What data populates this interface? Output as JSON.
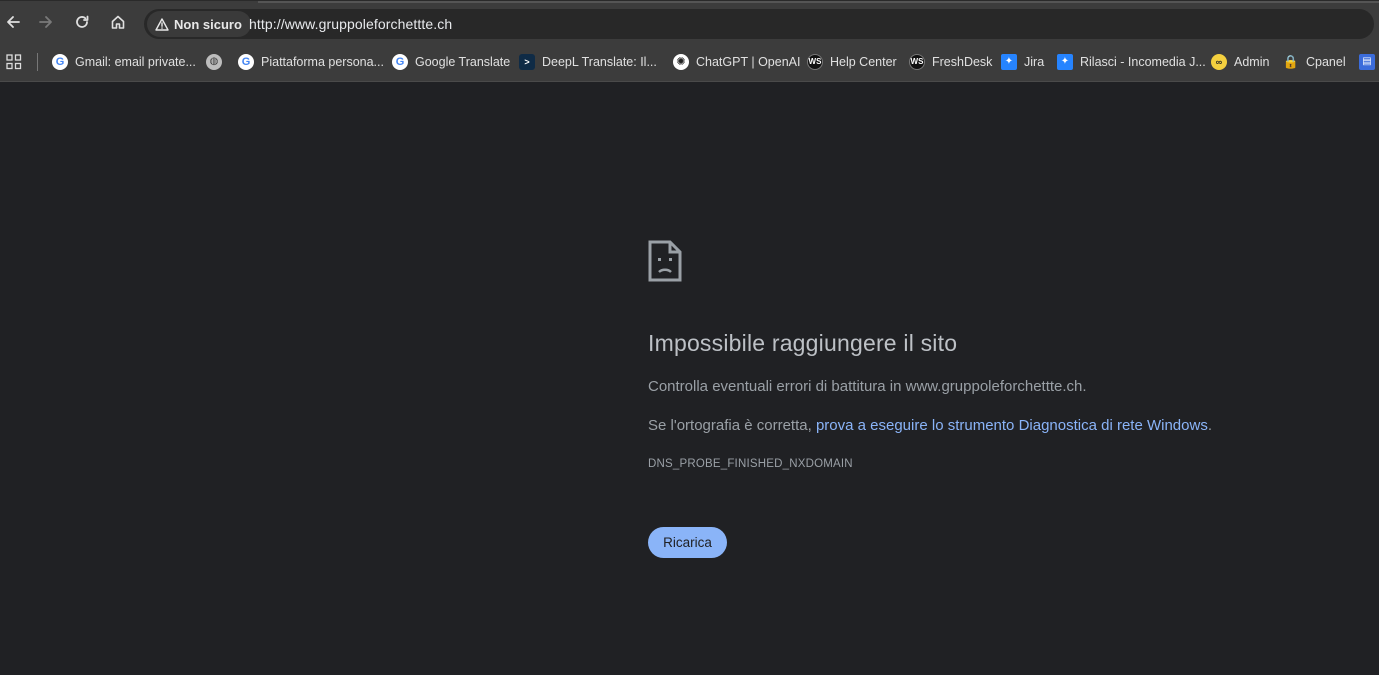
{
  "toolbar": {
    "security_label": "Non sicuro",
    "url": "http://www.gruppoleforchettte.ch"
  },
  "bookmarks": [
    {
      "label": "Gmail: email private...",
      "icon": "google-icon"
    },
    {
      "label": "",
      "icon": "globe-icon"
    },
    {
      "label": "Piattaforma persona...",
      "icon": "google-icon"
    },
    {
      "label": "Google Translate",
      "icon": "google-icon"
    },
    {
      "label": "DeepL Translate: Il...",
      "icon": "deepl-icon"
    },
    {
      "label": "ChatGPT | OpenAI",
      "icon": "openai-icon"
    },
    {
      "label": "Help Center",
      "icon": "ws-icon"
    },
    {
      "label": "FreshDesk",
      "icon": "ws-icon"
    },
    {
      "label": "Jira",
      "icon": "jira-icon"
    },
    {
      "label": "Rilasci - Incomedia J...",
      "icon": "jira-icon"
    },
    {
      "label": "Admin",
      "icon": "admin-icon"
    },
    {
      "label": "Cpanel",
      "icon": "cpanel-icon"
    },
    {
      "label": "",
      "icon": "bookmark-app-icon"
    }
  ],
  "error": {
    "title": "Impossibile raggiungere il sito",
    "line1": "Controlla eventuali errori di battitura in www.gruppoleforchettte.ch.",
    "line2_prefix": "Se l'ortografia è corretta, ",
    "line2_link": "prova a eseguire lo strumento Diagnostica di rete Windows",
    "line2_suffix": ".",
    "code": "DNS_PROBE_FINISHED_NXDOMAIN",
    "reload_label": "Ricarica"
  },
  "colors": {
    "page_bg": "#202124",
    "toolbar_bg": "#3c3c3c",
    "link": "#8ab4f8",
    "button_bg": "#8ab4f8"
  }
}
